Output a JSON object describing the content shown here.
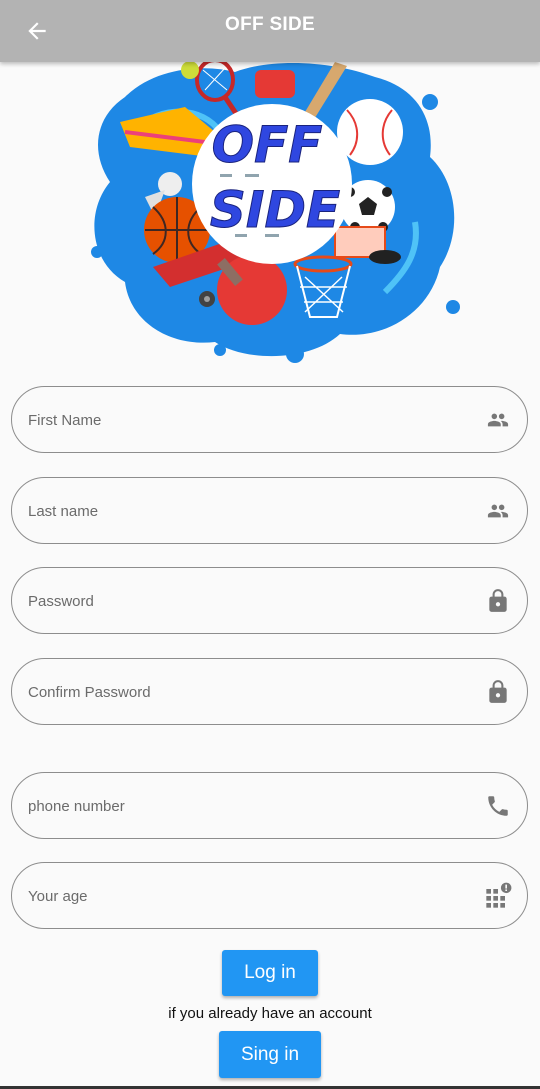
{
  "appbar": {
    "title": "OFF SIDE",
    "back_icon": "arrow-left-icon"
  },
  "logo": {
    "line1": "OFF",
    "line2": "SIDE"
  },
  "form": {
    "first_name": {
      "placeholder": "First Name",
      "value": "",
      "icon": "people-icon"
    },
    "last_name": {
      "placeholder": "Last name",
      "value": "",
      "icon": "people-icon"
    },
    "password": {
      "placeholder": "Password",
      "value": "",
      "icon": "lock-icon"
    },
    "confirm_password": {
      "placeholder": "Confirm Password",
      "value": "",
      "icon": "lock-icon"
    },
    "phone": {
      "placeholder": "phone number",
      "value": "",
      "icon": "phone-icon"
    },
    "age": {
      "placeholder": "Your age",
      "value": "",
      "icon": "dialpad-alert-icon"
    }
  },
  "actions": {
    "login_label": "Log in",
    "hint": "if you already have an account",
    "signin_label": "Sing in"
  },
  "colors": {
    "appbar": "#b3b3b3",
    "accent": "#2196f3",
    "background": "#fafafa",
    "logo_blue": "#1e88e5",
    "logo_text": "#2f47e0"
  }
}
